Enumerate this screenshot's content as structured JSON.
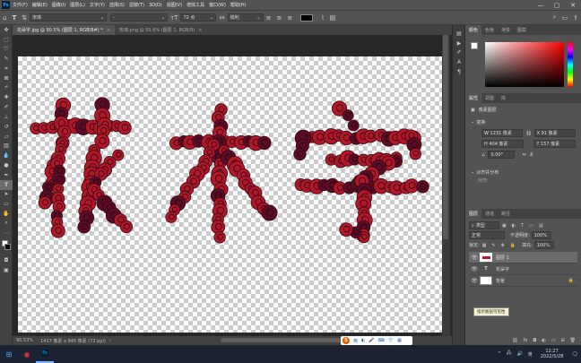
{
  "menubar": {
    "app_icon": "Ps",
    "items": [
      "文件(F)",
      "编辑(E)",
      "图像(I)",
      "图层(L)",
      "文字(Y)",
      "选择(S)",
      "滤镜(T)",
      "3D(D)",
      "视图(V)",
      "增效工具",
      "窗口(W)",
      "帮助(H)"
    ],
    "win_controls": [
      "—",
      "▢",
      "✕"
    ]
  },
  "optbar": {
    "font_family": "宋体",
    "font_style": "-",
    "font_size": "72 点",
    "aa_method": "锐利"
  },
  "tabs": [
    {
      "label": "花朵字.jpg @ 90.5% (图层 1, RGB/8#) *",
      "active": true
    },
    {
      "label": "玫瑰.png @ 55.6% (图层 1, RGB/8)",
      "active": false
    }
  ],
  "status": {
    "zoom": "90.53%",
    "doc_size": "1417 像素 x 945 像素 (72 ppi)"
  },
  "color_panel": {
    "tabs": [
      "颜色",
      "色板",
      "渐变",
      "图案"
    ]
  },
  "properties_panel": {
    "tabs": [
      "属性",
      "调整",
      "库"
    ],
    "layer_kind": "像素图层",
    "transform_label": "变换",
    "w": "W  1231 像素",
    "h": "H  404 像素",
    "x": "X  91 像素",
    "y": "Y  157 像素",
    "angle": "0.00°",
    "align_label": "对齐并分布",
    "align_sub": "对齐:"
  },
  "layers_panel": {
    "tabs": [
      "图层",
      "通道",
      "路径"
    ],
    "kind_filter": "类型",
    "blend_mode": "正常",
    "opacity_label": "不透明度:",
    "opacity": "100%",
    "lock_label": "锁定:",
    "fill_label": "填充:",
    "fill": "100%",
    "layers": [
      {
        "name": "图层 1",
        "type": "pixel",
        "selected": true
      },
      {
        "name": "花朵字",
        "type": "text",
        "selected": false
      },
      {
        "name": "背景",
        "type": "background",
        "selected": false
      }
    ],
    "tooltip": "指示图层可见性"
  },
  "ime": {
    "label": "英"
  },
  "taskbar": {
    "time": "12:27",
    "date": "2022/5/28"
  },
  "colors": {
    "rose": "#b0182a",
    "rose_dark": "#5a0c26"
  }
}
